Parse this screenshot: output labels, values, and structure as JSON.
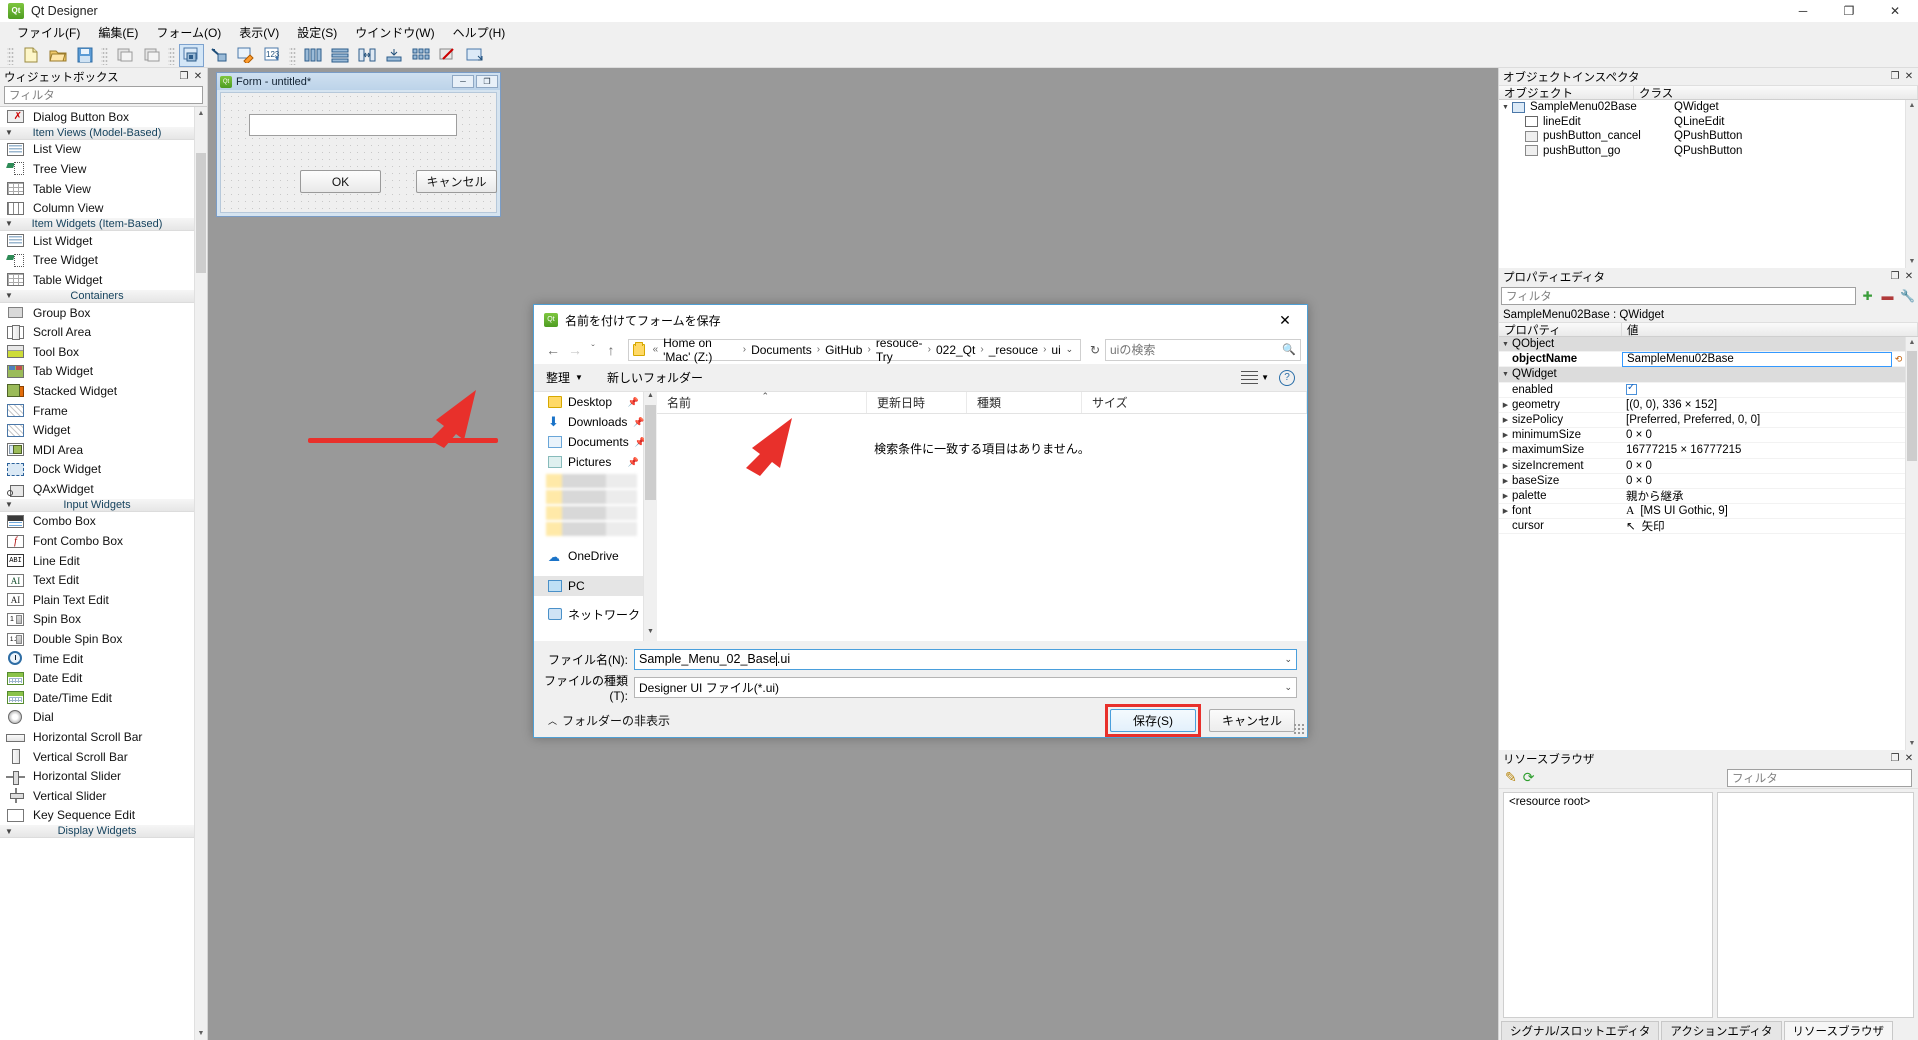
{
  "app": {
    "title": "Qt Designer",
    "icon": "qt-logo-icon",
    "window_buttons": {
      "minimize": "─",
      "maximize": "❐",
      "close": "✕"
    },
    "menus": [
      "ファイル(F)",
      "編集(E)",
      "フォーム(O)",
      "表示(V)",
      "設定(S)",
      "ウインドウ(W)",
      "ヘルプ(H)"
    ]
  },
  "widget_box": {
    "title": "ウィジェットボックス",
    "filter_placeholder": "フィルタ",
    "dock_buttons": {
      "float": "❐",
      "close": "✕"
    },
    "groups": [
      {
        "label": "",
        "collapsed_partial": true,
        "items": [
          {
            "label": "Dialog Button Box",
            "icon": "dialog-button-box-icon"
          }
        ]
      },
      {
        "label": "Item Views (Model-Based)",
        "items": [
          {
            "label": "List View",
            "icon": "list-view-icon"
          },
          {
            "label": "Tree View",
            "icon": "tree-view-icon"
          },
          {
            "label": "Table View",
            "icon": "table-view-icon"
          },
          {
            "label": "Column View",
            "icon": "column-view-icon"
          }
        ]
      },
      {
        "label": "Item Widgets (Item-Based)",
        "items": [
          {
            "label": "List Widget",
            "icon": "list-widget-icon"
          },
          {
            "label": "Tree Widget",
            "icon": "tree-widget-icon"
          },
          {
            "label": "Table Widget",
            "icon": "table-widget-icon"
          }
        ]
      },
      {
        "label": "Containers",
        "items": [
          {
            "label": "Group Box",
            "icon": "group-box-icon"
          },
          {
            "label": "Scroll Area",
            "icon": "scroll-area-icon"
          },
          {
            "label": "Tool Box",
            "icon": "tool-box-icon"
          },
          {
            "label": "Tab Widget",
            "icon": "tab-widget-icon"
          },
          {
            "label": "Stacked Widget",
            "icon": "stacked-widget-icon"
          },
          {
            "label": "Frame",
            "icon": "frame-icon"
          },
          {
            "label": "Widget",
            "icon": "widget-icon"
          },
          {
            "label": "MDI Area",
            "icon": "mdi-area-icon"
          },
          {
            "label": "Dock Widget",
            "icon": "dock-widget-icon"
          },
          {
            "label": "QAxWidget",
            "icon": "qax-widget-icon"
          }
        ]
      },
      {
        "label": "Input Widgets",
        "items": [
          {
            "label": "Combo Box",
            "icon": "combo-box-icon"
          },
          {
            "label": "Font Combo Box",
            "icon": "font-combo-box-icon"
          },
          {
            "label": "Line Edit",
            "icon": "line-edit-icon"
          },
          {
            "label": "Text Edit",
            "icon": "text-edit-icon"
          },
          {
            "label": "Plain Text Edit",
            "icon": "plain-text-edit-icon"
          },
          {
            "label": "Spin Box",
            "icon": "spin-box-icon"
          },
          {
            "label": "Double Spin Box",
            "icon": "double-spin-box-icon"
          },
          {
            "label": "Time Edit",
            "icon": "time-edit-icon"
          },
          {
            "label": "Date Edit",
            "icon": "date-edit-icon"
          },
          {
            "label": "Date/Time Edit",
            "icon": "date-time-edit-icon"
          },
          {
            "label": "Dial",
            "icon": "dial-icon"
          },
          {
            "label": "Horizontal Scroll Bar",
            "icon": "horizontal-scroll-bar-icon"
          },
          {
            "label": "Vertical Scroll Bar",
            "icon": "vertical-scroll-bar-icon"
          },
          {
            "label": "Horizontal Slider",
            "icon": "horizontal-slider-icon"
          },
          {
            "label": "Vertical Slider",
            "icon": "vertical-slider-icon"
          },
          {
            "label": "Key Sequence Edit",
            "icon": "key-sequence-edit-icon"
          }
        ]
      },
      {
        "label": "Display Widgets",
        "items": []
      }
    ]
  },
  "form_window": {
    "title": "Form - untitled*",
    "buttons": {
      "minimize": "─",
      "maximize": "❐"
    },
    "ok_label": "OK",
    "cancel_label": "キャンセル"
  },
  "object_inspector": {
    "title": "オブジェクトインスペクタ",
    "columns": [
      "オブジェクト",
      "クラス"
    ],
    "rows": [
      {
        "object": "SampleMenu02Base",
        "class": "QWidget",
        "indent": 0,
        "expanded": true
      },
      {
        "object": "lineEdit",
        "class": "QLineEdit",
        "indent": 1
      },
      {
        "object": "pushButton_cancel",
        "class": "QPushButton",
        "indent": 1
      },
      {
        "object": "pushButton_go",
        "class": "QPushButton",
        "indent": 1
      }
    ]
  },
  "property_editor": {
    "title": "プロパティエディタ",
    "filter_placeholder": "フィルタ",
    "object_header": "SampleMenu02Base : QWidget",
    "columns": [
      "プロパティ",
      "値"
    ],
    "rows": [
      {
        "name": "QObject",
        "value": "",
        "group": true
      },
      {
        "name": "objectName",
        "value": "SampleMenu02Base",
        "selected": true,
        "indent": 1
      },
      {
        "name": "QWidget",
        "value": "",
        "group": true
      },
      {
        "name": "enabled",
        "value": "",
        "checkbox": true,
        "indent": 1
      },
      {
        "name": "geometry",
        "value": "[(0, 0), 336 × 152]",
        "indent": 1,
        "expandable": true
      },
      {
        "name": "sizePolicy",
        "value": "[Preferred, Preferred, 0, 0]",
        "indent": 1,
        "expandable": true
      },
      {
        "name": "minimumSize",
        "value": "0 × 0",
        "indent": 1,
        "expandable": true
      },
      {
        "name": "maximumSize",
        "value": "16777215 × 16777215",
        "indent": 1,
        "expandable": true
      },
      {
        "name": "sizeIncrement",
        "value": "0 × 0",
        "indent": 1,
        "expandable": true
      },
      {
        "name": "baseSize",
        "value": "0 × 0",
        "indent": 1,
        "expandable": true
      },
      {
        "name": "palette",
        "value": "親から継承",
        "indent": 1,
        "expandable": true
      },
      {
        "name": "font",
        "value": "[MS UI Gothic, 9]",
        "indent": 1,
        "expandable": true,
        "prefix": "A"
      },
      {
        "name": "cursor",
        "value": "矢印",
        "indent": 1,
        "prefix": "cursor"
      }
    ]
  },
  "resource_browser": {
    "title": "リソースブラウザ",
    "filter_placeholder": "フィルタ",
    "root_label": "<resource root>",
    "edit_icon": "pencil-icon",
    "reload_icon": "reload-icon"
  },
  "bottom_tabs": [
    {
      "label": "シグナル/スロットエディタ",
      "active": false
    },
    {
      "label": "アクションエディタ",
      "active": false
    },
    {
      "label": "リソースブラウザ",
      "active": true
    }
  ],
  "save_dialog": {
    "title": "名前を付けてフォームを保存",
    "close_label": "✕",
    "nav": {
      "back": "←",
      "forward": "→",
      "recent": "ˇ",
      "up": "↑",
      "refresh": "↻"
    },
    "breadcrumb_prefix": "«",
    "breadcrumb": [
      "Home on 'Mac' (Z:)",
      "Documents",
      "GitHub",
      "resouce-Try",
      "022_Qt",
      "_resouce",
      "ui"
    ],
    "search_placeholder": "uiの検索",
    "organize_label": "整理",
    "new_folder_label": "新しいフォルダー",
    "places": [
      {
        "label": "Desktop",
        "icon": "folder-icon",
        "pinned": true
      },
      {
        "label": "Downloads",
        "icon": "download-icon",
        "pinned": true
      },
      {
        "label": "Documents",
        "icon": "documents-icon",
        "pinned": true
      },
      {
        "label": "Pictures",
        "icon": "pictures-icon",
        "pinned": true
      },
      {
        "label": "",
        "icon": "blurred-item",
        "blurred": true
      },
      {
        "label": "",
        "icon": "blurred-item",
        "blurred": true
      },
      {
        "label": "",
        "icon": "blurred-item",
        "blurred": true
      },
      {
        "label": "",
        "icon": "blurred-item",
        "blurred": true
      },
      {
        "label": "OneDrive",
        "icon": "onedrive-icon"
      },
      {
        "label": "PC",
        "icon": "pc-icon",
        "selected": true
      },
      {
        "label": "ネットワーク",
        "icon": "network-icon"
      }
    ],
    "file_columns": [
      "名前",
      "更新日時",
      "種類",
      "サイズ"
    ],
    "empty_message": "検索条件に一致する項目はありません。",
    "file_name_label": "ファイル名(N):",
    "file_name_value": "Sample_Menu_02_Base.ui",
    "file_name_before_caret": "Sample_Menu_02_Base",
    "file_name_after_caret": ".ui",
    "file_type_label": "ファイルの種類(T):",
    "file_type_value": "Designer UI ファイル(*.ui)",
    "hide_folders_label": "フォルダーの非表示",
    "save_button": "保存(S)",
    "cancel_button": "キャンセル",
    "highlight_color": "#e8302b"
  }
}
